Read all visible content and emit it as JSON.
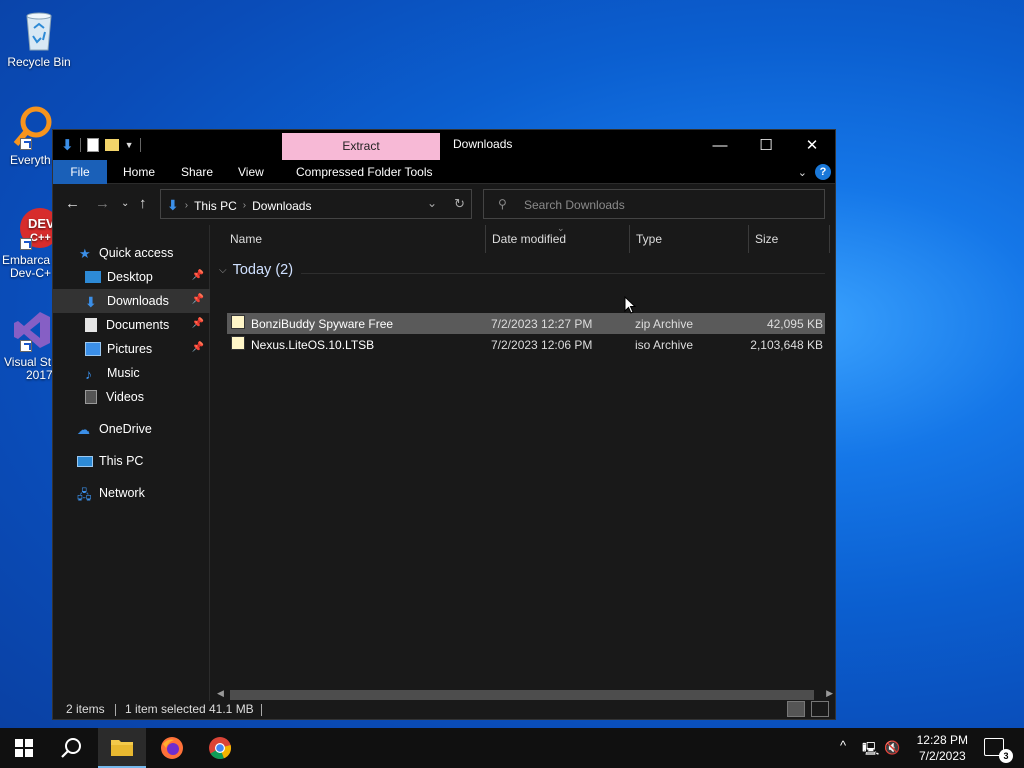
{
  "desktop": {
    "icons": [
      {
        "label": "Recycle Bin",
        "icon": "recycle-bin-icon"
      },
      {
        "label": "Everyth",
        "icon": "everything-search-icon"
      },
      {
        "label": "Embarca\nDev-C+",
        "line1": "Embarca",
        "line2": "Dev-C+",
        "icon": "devcpp-icon"
      },
      {
        "label": "Visual St\n2017",
        "line1": "Visual St",
        "line2": "2017",
        "icon": "visual-studio-icon"
      }
    ]
  },
  "window": {
    "title": "Downloads",
    "contextual_tab": "Extract",
    "controls": {
      "minimize": "—",
      "maximize": "☐",
      "close": "✕"
    },
    "ribbon_tabs": [
      "File",
      "Home",
      "Share",
      "View",
      "Compressed Folder Tools"
    ],
    "address": {
      "crumbs": [
        "This PC",
        "Downloads"
      ]
    },
    "search": {
      "placeholder": "Search Downloads"
    },
    "sidebar": {
      "quick_access": "Quick access",
      "items": [
        {
          "label": "Desktop",
          "pinned": true,
          "icon": "desktop-icon"
        },
        {
          "label": "Downloads",
          "pinned": true,
          "selected": true,
          "icon": "downloads-icon"
        },
        {
          "label": "Documents",
          "pinned": true,
          "icon": "documents-icon"
        },
        {
          "label": "Pictures",
          "pinned": true,
          "icon": "pictures-icon"
        },
        {
          "label": "Music",
          "pinned": false,
          "icon": "music-icon"
        },
        {
          "label": "Videos",
          "pinned": false,
          "icon": "videos-icon"
        }
      ],
      "onedrive": "OneDrive",
      "this_pc": "This PC",
      "network": "Network"
    },
    "columns": [
      "Name",
      "Date modified",
      "Type",
      "Size"
    ],
    "group": {
      "label": "Today (2)"
    },
    "files": [
      {
        "name": "BonziBuddy Spyware Free",
        "date": "7/2/2023 12:27 PM",
        "type": "zip Archive",
        "size": "42,095 KB",
        "selected": true,
        "icon_letter": "Z"
      },
      {
        "name": "Nexus.LiteOS.10.LTSB",
        "date": "7/2/2023 12:06 PM",
        "type": "iso Archive",
        "size": "2,103,648 KB",
        "selected": false,
        "icon_letter": "ISO"
      }
    ],
    "status": {
      "items": "2 items",
      "selected": "1 item selected",
      "size": "41.1 MB"
    }
  },
  "taskbar": {
    "time": "12:28 PM",
    "date": "7/2/2023",
    "notifications": "3"
  },
  "colors": {
    "accent": "#1a60b8",
    "extract_tab": "#f7b9d6",
    "window_bg": "#191919",
    "selection": "#5a5a5a"
  }
}
